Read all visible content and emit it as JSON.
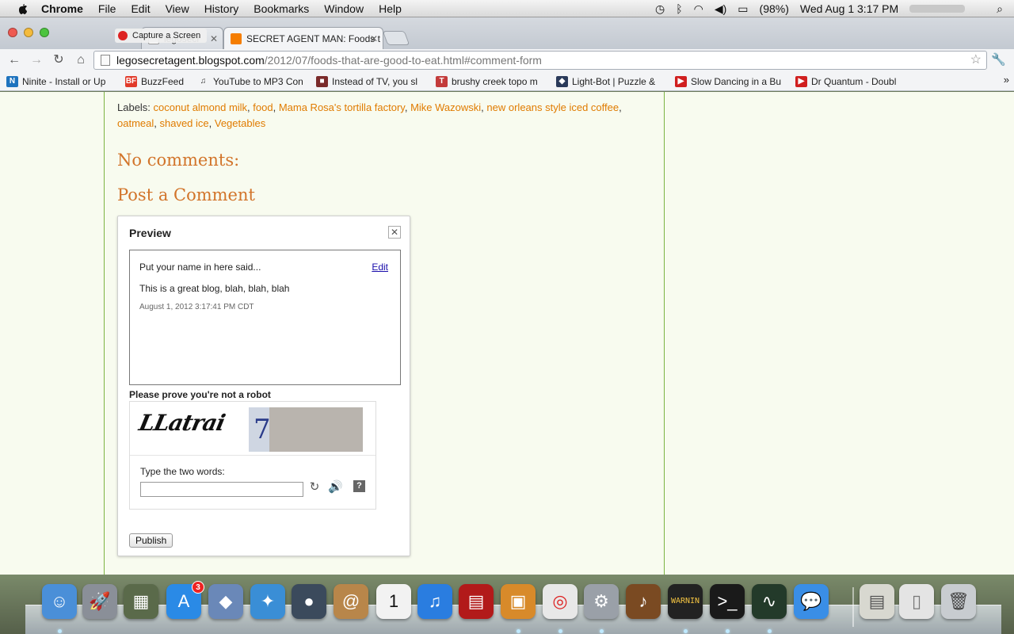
{
  "menubar": {
    "app_name": "Chrome",
    "items": [
      "File",
      "Edit",
      "View",
      "History",
      "Bookmarks",
      "Window",
      "Help"
    ],
    "battery": "(98%)",
    "clock": "Wed Aug 1  3:17 PM"
  },
  "overlay": {
    "label": "Capture a Screen"
  },
  "tabs": [
    {
      "title": "legosecr",
      "favicon_color": "#ffffff"
    },
    {
      "title": "SECRET AGENT MAN: Foods t",
      "favicon_color": "#f57d00"
    }
  ],
  "toolbar": {
    "url_host": "legosecretagent.blogspot.com",
    "url_path": "/2012/07/foods-that-are-good-to-eat.html#comment-form"
  },
  "bookmarks": [
    {
      "label": "Ninite - Install or Up",
      "icon_text": "N",
      "icon_color": "#1e73be"
    },
    {
      "label": "BuzzFeed",
      "icon_text": "BF",
      "icon_color": "#e13a2a"
    },
    {
      "label": "YouTube to MP3 Con",
      "icon_text": "♫",
      "icon_color": "#333333"
    },
    {
      "label": "Instead of TV, you sl",
      "icon_text": "■",
      "icon_color": "#7a2a2a"
    },
    {
      "label": "brushy creek topo m",
      "icon_text": "T",
      "icon_color": "#c33b3b"
    },
    {
      "label": "Light-Bot | Puzzle &",
      "icon_text": "◆",
      "icon_color": "#2a3a5a"
    },
    {
      "label": "Slow Dancing in a Bu",
      "icon_text": "▶",
      "icon_color": "#d01f1f"
    },
    {
      "label": "Dr Quantum - Doubl",
      "icon_text": "▶",
      "icon_color": "#d01f1f"
    }
  ],
  "post": {
    "labels_prefix": "Labels:",
    "labels": [
      "coconut almond milk",
      "food",
      "Mama Rosa's tortilla factory",
      "Mike Wazowski",
      "new orleans style iced coffee",
      "oatmeal",
      "shaved ice",
      "Vegetables"
    ],
    "no_comments": "No comments:",
    "post_a_comment": "Post a Comment"
  },
  "preview": {
    "title": "Preview",
    "author_line": "Put your name in here said...",
    "edit_link": "Edit",
    "body": "This is a great blog, blah, blah, blah",
    "date": "August 1, 2012 3:17:41 PM CDT",
    "robot_prompt": "Please prove you're not a robot",
    "captcha_word1": "LLatrai",
    "captcha_word2_hint": "7",
    "type_label": "Type the two words:",
    "captcha_input_value": "",
    "publish_label": "Publish"
  },
  "dock": {
    "apps": [
      {
        "name": "Finder",
        "color": "#4a8fd8",
        "glyph": "☺"
      },
      {
        "name": "Launchpad",
        "color": "#8a8f98",
        "glyph": "🚀"
      },
      {
        "name": "Photo Booth",
        "color": "#5a6a4a",
        "glyph": "▦"
      },
      {
        "name": "App Store",
        "color": "#2a8ae6",
        "glyph": "A",
        "badge": "3"
      },
      {
        "name": "Preview",
        "color": "#6a88b8",
        "glyph": "◆"
      },
      {
        "name": "Safari",
        "color": "#3a8ed6",
        "glyph": "✦"
      },
      {
        "name": "FaceTime",
        "color": "#3b4a5c",
        "glyph": "●"
      },
      {
        "name": "Address Book",
        "color": "#b8864a",
        "glyph": "@"
      },
      {
        "name": "Calendar",
        "color": "#f2f2f2",
        "glyph": "1",
        "glyph_color": "#111111"
      },
      {
        "name": "iTunes",
        "color": "#2a7de0",
        "glyph": "♫"
      },
      {
        "name": "Photo Booth 2",
        "color": "#b21a1a",
        "glyph": "▤"
      },
      {
        "name": "iPhoto",
        "color": "#d88a2a",
        "glyph": "▣"
      },
      {
        "name": "Chrome",
        "color": "#e8e8e8",
        "glyph": "◎",
        "glyph_color": "#d22"
      },
      {
        "name": "System Preferences",
        "color": "#9aa0a8",
        "glyph": "⚙"
      },
      {
        "name": "GarageBand",
        "color": "#7a4a22",
        "glyph": "♪"
      },
      {
        "name": "Console",
        "color": "#222222",
        "glyph": "WARNIN",
        "glyph_color": "#f5c542"
      },
      {
        "name": "Terminal",
        "color": "#1a1a1a",
        "glyph": ">_"
      },
      {
        "name": "Activity Monitor",
        "color": "#233a2a",
        "glyph": "∿"
      },
      {
        "name": "iChat",
        "color": "#3a8ee6",
        "glyph": "💬"
      },
      {
        "name": "Downloads",
        "color": "#d8d8d0",
        "glyph": "▤",
        "glyph_color": "#555555"
      },
      {
        "name": "Documents",
        "color": "#e4e4e4",
        "glyph": "▯",
        "glyph_color": "#777777"
      },
      {
        "name": "Trash",
        "color": "#c8ccd0",
        "glyph": "🗑",
        "glyph_color": "#444444"
      }
    ]
  }
}
